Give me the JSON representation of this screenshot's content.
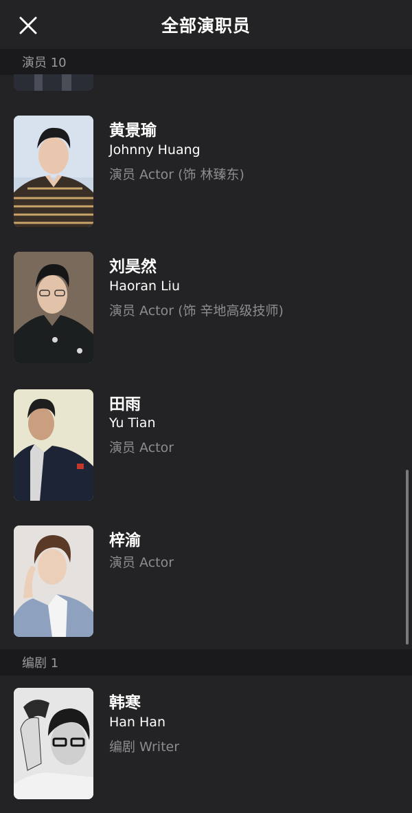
{
  "header": {
    "title": "全部演职员",
    "close_icon": "close-icon"
  },
  "sections": [
    {
      "label": "演员 10"
    },
    {
      "label": "编剧 1"
    }
  ],
  "people": [
    {
      "name": "黄景瑜",
      "english_name": "Johnny Huang",
      "role": "演员 Actor (饰 林臻东)"
    },
    {
      "name": "刘昊然",
      "english_name": "Haoran Liu",
      "role": "演员 Actor (饰 辛地高级技师)"
    },
    {
      "name": "田雨",
      "english_name": "Yu Tian",
      "role": "演员 Actor"
    },
    {
      "name": "梓渝",
      "english_name": "",
      "role": "演员 Actor"
    },
    {
      "name": "韩寒",
      "english_name": "Han Han",
      "role": "编剧 Writer"
    }
  ],
  "colors": {
    "background": "#232325",
    "section_bg": "#1a1a1c",
    "secondary_text": "#8d8d90"
  }
}
